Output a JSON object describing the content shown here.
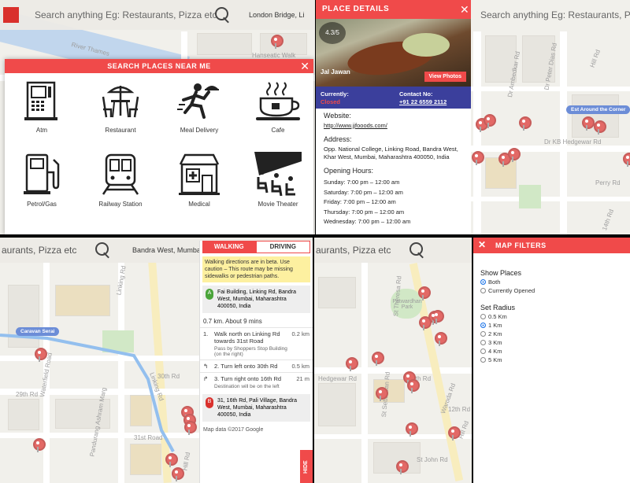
{
  "top_left": {
    "search": {
      "placeholder": "Search anything Eg: Restaurants, Pizza etc",
      "location": "London Bridge, Li"
    },
    "map_labels": [
      "River Thames",
      "Hanseatic Walk"
    ],
    "modal": {
      "title": "SEARCH PLACES NEAR ME",
      "categories": [
        {
          "label": "Atm",
          "icon": "atm-icon"
        },
        {
          "label": "Restaurant",
          "icon": "restaurant-icon"
        },
        {
          "label": "Meal Delivery",
          "icon": "meal-delivery-icon"
        },
        {
          "label": "Cafe",
          "icon": "cafe-icon"
        },
        {
          "label": "Petrol/Gas",
          "icon": "petrol-pump-icon"
        },
        {
          "label": "Railway Station",
          "icon": "train-icon"
        },
        {
          "label": "Medical",
          "icon": "hospital-icon"
        },
        {
          "label": "Movie Theater",
          "icon": "movie-theater-icon"
        }
      ]
    }
  },
  "top_right": {
    "search_text": "Search anything Eg: Restaurants, Pizza etc",
    "tooltip": "Est Around the Corner",
    "map_labels": [
      "Dr Ambedkar Rd",
      "Dr Peter Dias Rd",
      "Dr KB Hedgewar Rd",
      "Perry Rd",
      "Hill Rd",
      "14th Rd"
    ],
    "place": {
      "header": "PLACE DETAILS",
      "rating": "4.3/5",
      "name": "Jal Jawan",
      "view_photos": "View Photos",
      "currently_label": "Currently:",
      "currently_value": "Closed",
      "contact_label": "Contact No:",
      "contact_value": "+91 22 6559 2112",
      "website_label": "Website:",
      "website_value": "http://www.jjfooods.com/",
      "address_label": "Address:",
      "address_value": "Opp. National College, Linking Road, Bandra West, Khar West, Mumbai, Maharashtra 400050, India",
      "hours_label": "Opening Hours:",
      "hours": [
        "Sunday: 7:00 pm – 12:00 am",
        "Saturday: 7:00 pm – 12:00 am",
        "Friday: 7:00 pm – 12:00 am",
        "Thursday: 7:00 pm – 12:00 am",
        "Wednesday: 7:00 pm – 12:00 am"
      ]
    }
  },
  "bottom_left": {
    "search_text": "aurants, Pizza etc",
    "location": "Bandra West, Mumba",
    "tooltip": "Caravan Serai",
    "map_labels": [
      "Linking Rd",
      "30th Rd",
      "29th Rd",
      "31st Road",
      "Waterfield Road",
      "Pandurang Ashram Marg",
      "Linking Rd",
      "Hill Rd"
    ],
    "directions": {
      "tabs": [
        "WALKING",
        "DRIVING"
      ],
      "warning": "Walking directions are in beta. Use caution – This route may be missing sidewalks or pedestrian paths.",
      "start_marker": "A",
      "start_address": "Fai Building, Linking Rd, Bandra West, Mumbai, Maharashtra 400050, India",
      "summary": "0.7 km. About 9 mins",
      "steps": [
        {
          "num": "1.",
          "html_text": "Walk north on Linking Rd towards 31st Road",
          "sub": "Pass by Shoppers Stop Building (on the right)",
          "dist": "0.2 km"
        },
        {
          "num": "2.",
          "html_text": "Turn left onto 30th Rd",
          "sub": "",
          "dist": "0.5 km"
        },
        {
          "num": "3.",
          "html_text": "Turn right onto 16th Rd",
          "sub": "Destination will be on the left",
          "dist": "21 m"
        }
      ],
      "end_marker": "B",
      "end_address": "31, 16th Rd, Pali Village, Bandra West, Mumbai, Maharashtra 400050, India",
      "footer": "Map data ©2017 Google",
      "hide": "HIDE"
    }
  },
  "bottom_middle": {
    "search_text": "aurants, Pizza etc",
    "map_labels": [
      "Patwardhan Park",
      "St Theresa Rd",
      "Hedgewar Rd",
      "14th Rd",
      "Waroda Rd",
      "St Sebastian Rd",
      "12th Rd",
      "St John Rd",
      "Hill Rd"
    ]
  },
  "bottom_right": {
    "header": "MAP FILTERS",
    "show_places_label": "Show Places",
    "show_options": [
      {
        "label": "Both",
        "selected": true
      },
      {
        "label": "Currently Opened",
        "selected": false
      }
    ],
    "radius_label": "Set Radius",
    "radius_options": [
      {
        "label": "0.5 Km",
        "selected": false
      },
      {
        "label": "1 Km",
        "selected": true
      },
      {
        "label": "2 Km",
        "selected": false
      },
      {
        "label": "3 Km",
        "selected": false
      },
      {
        "label": "4 Km",
        "selected": false
      },
      {
        "label": "5 Km",
        "selected": false
      }
    ]
  },
  "colors": {
    "accent": "#f04a4a",
    "contact_bar": "#3b3f9c",
    "route": "#6aa7e8",
    "pin": "#d9302c"
  }
}
